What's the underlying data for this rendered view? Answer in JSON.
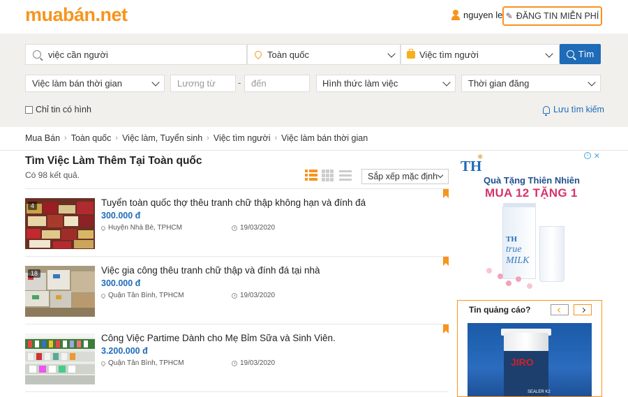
{
  "header": {
    "logo": "muabán.net",
    "user_name": "nguyen le",
    "post_button": "ĐĂNG TIN MIỄN PHÍ"
  },
  "search": {
    "keyword_value": "việc cần người",
    "location_value": "Toàn quốc",
    "category_value": "Việc tìm người",
    "search_button": "Tìm",
    "job_type_value": "Việc làm bán thời gian",
    "salary_from_placeholder": "Lương từ",
    "salary_to_placeholder": "đến",
    "salary_separator": "-",
    "work_form_value": "Hình thức làm việc",
    "post_time_value": "Thời gian đăng",
    "image_only_label": "Chỉ tin có hình",
    "save_search_label": "Lưu tìm kiếm"
  },
  "breadcrumb": [
    "Mua Bán",
    "Toàn quốc",
    "Việc làm, Tuyển sinh",
    "Việc tìm người",
    "Việc làm bán thời gian"
  ],
  "listing": {
    "title": "Tìm Việc Làm Thêm Tại Toàn quốc",
    "result_count": "Có 98 kết quả.",
    "sort_value": "Sắp xếp mặc định",
    "items": [
      {
        "title": "Tuyển toàn quốc thợ thêu tranh chữ thập không hạn và đính đá",
        "price": "300.000 đ",
        "location": "Huyện Nhà Bè, TPHCM",
        "date": "19/03/2020",
        "photo_count": "4"
      },
      {
        "title": "Việc gia công thêu tranh chữ thập và đính đá tại nhà",
        "price": "300.000 đ",
        "location": "Quận Tân Bình, TPHCM",
        "date": "19/03/2020",
        "photo_count": "18"
      },
      {
        "title": "Công Việc Partime Dành cho Mẹ Bỉm Sữa và Sinh Viên.",
        "price": "3.200.000 đ",
        "location": "Quận Tân Bình, TPHCM",
        "date": "19/03/2020",
        "photo_count": ""
      }
    ]
  },
  "ads": {
    "top": {
      "brand": "TH",
      "line1": "Quà Tặng Thiên Nhiên",
      "line2": "MUA 12 TẶNG 1",
      "product_brand": "TH",
      "product_word1": "true",
      "product_word2": "MILK"
    },
    "bottom": {
      "title": "Tin quảng cáo?",
      "product_logo": "JIRO",
      "product_label": "SEALER K2"
    }
  },
  "colors": {
    "brand_orange": "#f7941d",
    "link_blue": "#1e6bb8"
  }
}
